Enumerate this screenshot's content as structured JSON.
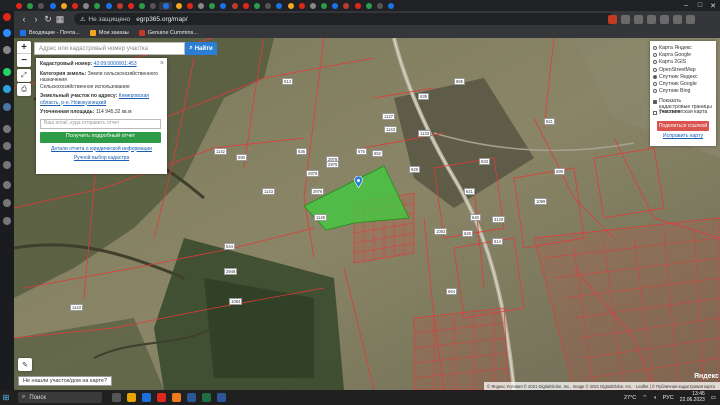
{
  "browser": {
    "tabs_count": 34,
    "security_label": "Не защищено",
    "url": "egrp365.org/map/",
    "window_controls": [
      "–",
      "□",
      "✕"
    ]
  },
  "bookmarks": [
    {
      "label": "Входящие - Почта...",
      "color": "#1a73e8"
    },
    {
      "label": "Мои заказы",
      "color": "#f5a623"
    },
    {
      "label": "Genuine Cummins...",
      "color": "#c0392b"
    }
  ],
  "map": {
    "search_placeholder": "Адрес или кадастровый номер участка",
    "find_label": "Найти",
    "zoom_in": "+",
    "zoom_out": "−",
    "not_found_label": "Не нашли участок/дом на карте?",
    "attribution": "© Яндекс Условия © 2021 DigitalGlobe, Inc., Image © 2021 DigitalGlobe, Inc. · Leaflet | © Публичная кадастровая карта",
    "yandex_logo": "Яндекс",
    "parcel_labels": [
      "614",
      "626",
      "2978",
      "675",
      "1143",
      "1127",
      "639",
      "636",
      "590",
      "2979",
      "2976",
      "2975",
      "1133",
      "655",
      "621",
      "614",
      "652",
      "629",
      "641",
      "640",
      "625",
      "1099",
      "633",
      "1093",
      "3129",
      "599",
      "664",
      "1143",
      "644",
      "2948",
      "1094",
      "1142",
      "1143",
      "1148"
    ]
  },
  "info_panel": {
    "cadastral_label": "Кадастровый номер:",
    "cadastral_value": "42:09:0000001:453",
    "category_label": "Категория земель:",
    "category_value": "Земли сельскохозяйственного назначения",
    "usage_value": "Сельскохозяйственное использование",
    "address_label": "Земельный участок по адресу:",
    "address_value": "Кемеровская область, р-н. Новокузнецкий",
    "area_label": "Уточненная площадь:",
    "area_value": "114 945.32 кв.м",
    "email_placeholder": "Ваш email, куда отправить отчет",
    "report_button": "Получить подробный отчет",
    "sample_link": "Детали отчета о юридической информации",
    "manual_link": "Ручной выбор кадастра"
  },
  "layers_panel": {
    "base_layers": [
      {
        "label": "Карта Яндекс",
        "selected": false
      },
      {
        "label": "Карта Google",
        "selected": false
      },
      {
        "label": "Карта 2GIS",
        "selected": false
      },
      {
        "label": "OpenStreetMap",
        "selected": false
      },
      {
        "label": "Спутник Яндекс",
        "selected": true
      },
      {
        "label": "Спутник Google",
        "selected": false
      },
      {
        "label": "Спутник Bing",
        "selected": false
      }
    ],
    "overlays": [
      {
        "label": "Показать кадастровые границы участков",
        "checked": true
      },
      {
        "label": "Тематическая карта",
        "checked": false
      }
    ],
    "share_button": "Поделиться ссылкой",
    "fix_link": "Исправить карту"
  },
  "taskbar": {
    "search_label": "Поиск",
    "weather": "27°C",
    "language": "РУС",
    "time": "13:45",
    "date": "22.06.2023"
  },
  "colors": {
    "selected_parcel": "#3ecf3e",
    "cadastral_border": "#e23a3a",
    "find_button": "#2a7fd4",
    "report_button": "#2e9c47",
    "share_button": "#d9534f"
  }
}
